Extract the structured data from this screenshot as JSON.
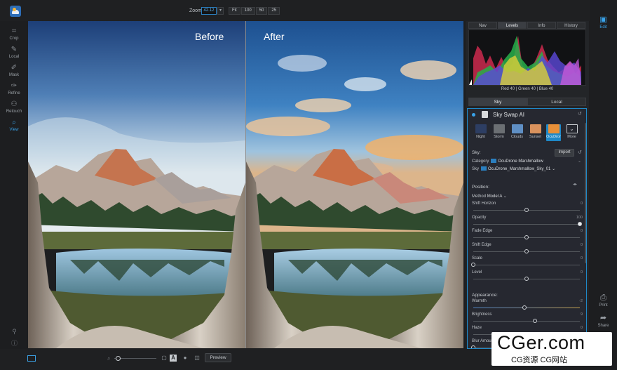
{
  "topbar": {
    "zoom_label": "Zoom",
    "zoom_value": "42.12",
    "zoom_buttons": [
      "Fit",
      "100",
      "50",
      "25"
    ]
  },
  "tools": [
    {
      "label": "Crop",
      "icon": "crop-icon",
      "glyph": "⌗"
    },
    {
      "label": "Local",
      "icon": "brush-icon",
      "glyph": "✎"
    },
    {
      "label": "Mask",
      "icon": "mask-brush-icon",
      "glyph": "✐"
    },
    {
      "label": "Refine",
      "icon": "refine-brush-icon",
      "glyph": "✑"
    },
    {
      "label": "Retouch",
      "icon": "retouch-icon",
      "glyph": "⚇"
    },
    {
      "label": "View",
      "icon": "view-zoom-icon",
      "glyph": "⌕"
    }
  ],
  "canvas": {
    "before_label": "Before",
    "after_label": "After"
  },
  "panel": {
    "top_tabs": [
      "Nav",
      "Levels",
      "Info",
      "History"
    ],
    "active_top_tab": "Levels",
    "histogram_readout": "Red  40  |  Green  40  |  Blue  40",
    "sub_tabs": [
      "Sky",
      "Local"
    ],
    "active_sub_tab": "Sky",
    "module_title": "Sky Swap AI",
    "presets": [
      {
        "label": "Night",
        "color": "#2d3e63"
      },
      {
        "label": "Storm",
        "color": "#6b6f73"
      },
      {
        "label": "Clouds",
        "color": "#5f8fc4"
      },
      {
        "label": "Sunset",
        "color": "#d9925d"
      },
      {
        "label": "OcuDrone",
        "color": "#e89038"
      },
      {
        "label": "More",
        "color": "#262830"
      }
    ],
    "sky_section": "Sky:",
    "import_label": "Import",
    "category_label": "Category",
    "category_value": "OcuDrone Marshmallow",
    "sky_label": "Sky",
    "sky_value": "OcuDrone_Marshmallow_Sky_01",
    "position_section": "Position:",
    "method_label": "Method",
    "method_value": "Model A",
    "controls": [
      {
        "label": "Shift Horizon",
        "value": "0",
        "pos": 0.5
      },
      {
        "label": "Opacity",
        "value": "100",
        "pos": 1.0
      },
      {
        "label": "Fade Edge",
        "value": "0",
        "pos": 0.5
      },
      {
        "label": "Shift Edge",
        "value": "0",
        "pos": 0.5
      },
      {
        "label": "Scale",
        "value": "0",
        "pos": 0.0
      },
      {
        "label": "Level",
        "value": "0",
        "pos": 0.5
      }
    ],
    "appearance_section": "Appearance:",
    "appearance_controls": [
      {
        "label": "Warmth",
        "value": "-2",
        "pos": 0.48
      },
      {
        "label": "Brightness",
        "value": "9",
        "pos": 0.58
      },
      {
        "label": "Haze",
        "value": "0",
        "pos": 0.5
      },
      {
        "label": "Blur Amou",
        "value": "",
        "pos": 0.0
      }
    ]
  },
  "right_column": {
    "edit_label": "Edit",
    "print_label": "Print",
    "share_label": "Share"
  },
  "bottombar": {
    "preview_label": "Preview",
    "mask_label": "A"
  },
  "watermark": {
    "big": "CGer.com",
    "small": "CG资源 CG网站"
  }
}
